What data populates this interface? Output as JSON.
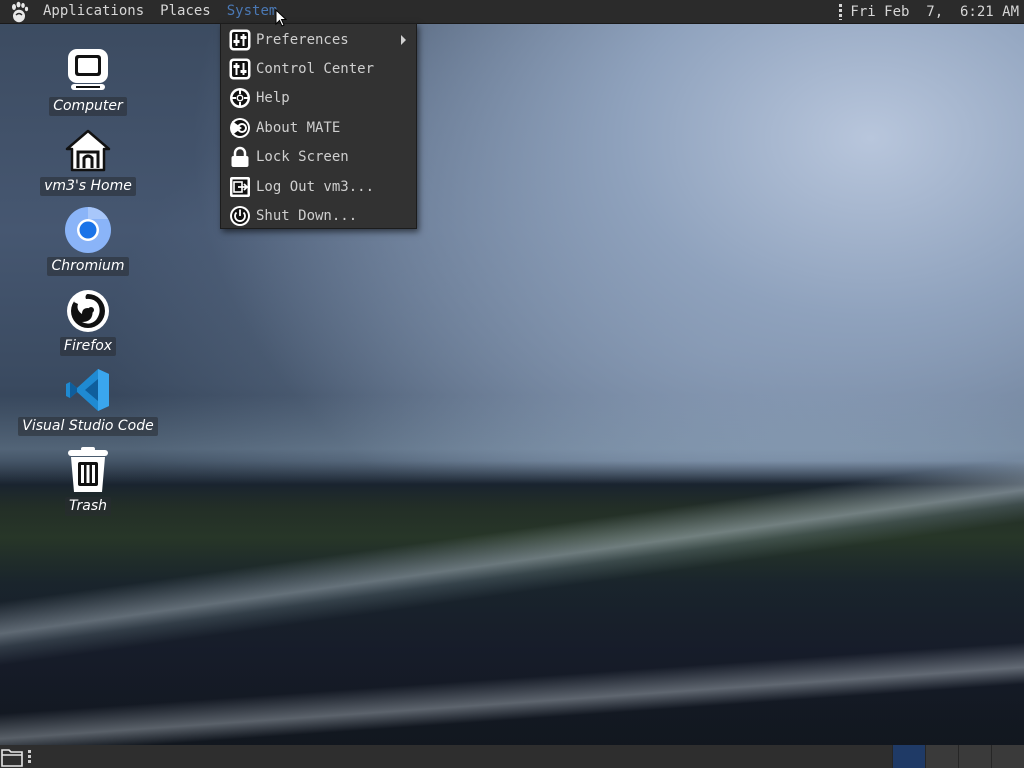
{
  "top_panel": {
    "menus": [
      "Applications",
      "Places",
      "System"
    ],
    "active_menu": "System",
    "clock": "Fri Feb  7,  6:21 AM"
  },
  "desktop_icons": [
    {
      "label": "Computer",
      "icon": "computer-icon"
    },
    {
      "label": "vm3's Home",
      "icon": "home-folder-icon"
    },
    {
      "label": "Chromium",
      "icon": "chromium-icon"
    },
    {
      "label": "Firefox",
      "icon": "firefox-icon"
    },
    {
      "label": "Visual Studio Code",
      "icon": "vscode-icon"
    },
    {
      "label": "Trash",
      "icon": "trash-icon"
    }
  ],
  "system_menu": {
    "items": [
      {
        "label": "Preferences",
        "icon": "preferences-icon",
        "submenu": true
      },
      {
        "label": "Control Center",
        "icon": "control-center-icon",
        "submenu": false
      },
      {
        "label": "Help",
        "icon": "help-icon",
        "submenu": false
      },
      {
        "label": "About MATE",
        "icon": "about-mate-icon",
        "submenu": false
      },
      {
        "label": "Lock Screen",
        "icon": "lock-icon",
        "submenu": false
      },
      {
        "label": "Log Out vm3...",
        "icon": "logout-icon",
        "submenu": false
      },
      {
        "label": "Shut Down...",
        "icon": "power-icon",
        "submenu": false
      }
    ]
  },
  "colors": {
    "panel_bg": "#2b2b2b",
    "menu_bg": "#323232",
    "active_menu_text": "#4a78b4",
    "active_workspace": "#1f3a66"
  }
}
